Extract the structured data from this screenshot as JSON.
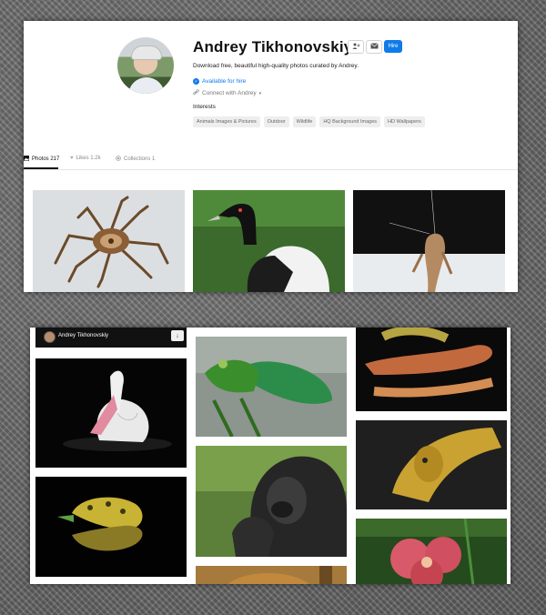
{
  "profile": {
    "name": "Andrey Tikhonovskiy",
    "bio": "Download free, beautiful high-quality photos curated by Andrey.",
    "availability": "Available for hire",
    "connect": "Connect with Andrey",
    "hire_label": "Hire",
    "interests_label": "Interests",
    "interests": [
      "Animals Images & Pictures",
      "Outdoor",
      "Wildlife",
      "HQ Background Images",
      "HD Wallpapers"
    ]
  },
  "tabs": {
    "photos": "Photos 217",
    "likes": "Likes 1.2k",
    "collections": "Collections 1"
  },
  "mini_header": {
    "name": "Andrey Tikhonovskiy"
  },
  "colors": {
    "accent": "#0f7be8"
  },
  "icons": {
    "follow": "person-plus-icon",
    "message": "mail-icon",
    "download": "download-icon",
    "verified": "check-circle-icon",
    "link": "link-icon"
  }
}
